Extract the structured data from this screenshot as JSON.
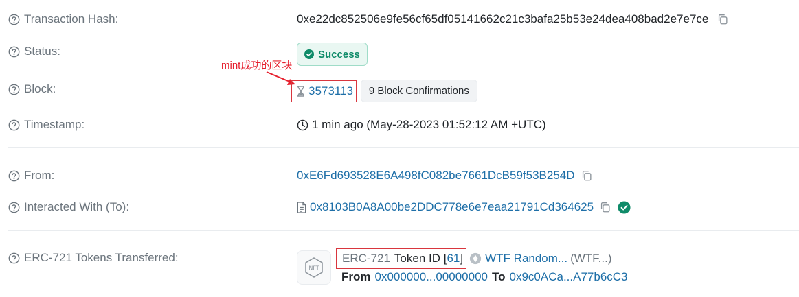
{
  "fields": {
    "tx_hash": {
      "label": "Transaction Hash:",
      "value": "0xe22dc852506e9fe56cf65df05141662c21c3bafa25b53e24dea408bad2e7e7ce"
    },
    "status": {
      "label": "Status:",
      "value": "Success"
    },
    "block": {
      "label": "Block:",
      "number": "3573113",
      "confirmations": "9 Block Confirmations"
    },
    "timestamp": {
      "label": "Timestamp:",
      "value": "1 min ago (May-28-2023 01:52:12 AM +UTC)"
    },
    "from": {
      "label": "From:",
      "value": "0xE6Fd693528E6A498fC082be7661DcB59f53B254D"
    },
    "to": {
      "label": "Interacted With (To):",
      "value": "0x8103B0A8A00be2DDC778e6e7eaa21791Cd364625"
    },
    "erc721": {
      "label": "ERC-721 Tokens Transferred:",
      "standard": "ERC-721",
      "token_id_prefix": "Token ID [",
      "token_id": "61",
      "token_id_suffix": "]",
      "token_name": "WTF Random...",
      "token_symbol": "(WTF...)",
      "from_label": "From",
      "from_addr": "0x000000...00000000",
      "to_label": "To",
      "to_addr": "0x9c0ACa...A77b6cC3"
    }
  },
  "annotation": {
    "text": "mint成功的区块"
  },
  "colors": {
    "link": "#1e6fa8",
    "success": "#0f8b69",
    "annotation": "#e6202e",
    "label": "#6c757d"
  }
}
